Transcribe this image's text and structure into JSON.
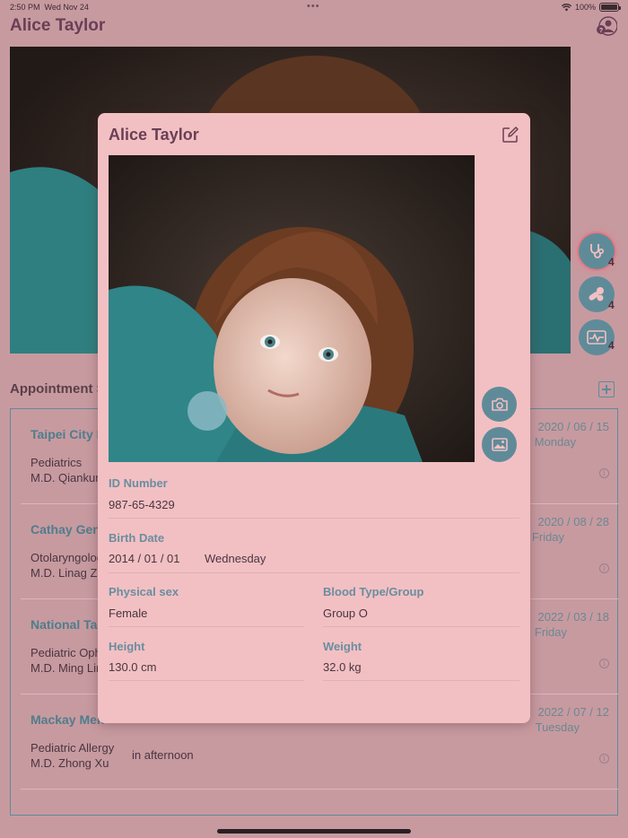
{
  "status_bar": {
    "time": "2:50 PM",
    "date": "Wed Nov 24",
    "battery": "100%"
  },
  "page": {
    "title": "Alice Taylor",
    "profile_icon": "person-help-icon"
  },
  "side_buttons": [
    {
      "icon": "stethoscope-icon",
      "badge": "4"
    },
    {
      "icon": "pills-icon",
      "badge": "4"
    },
    {
      "icon": "heart-monitor-icon",
      "badge": "4"
    }
  ],
  "appointments": {
    "title": "Appointment S",
    "items": [
      {
        "hospital": "Taipei City H",
        "department": "Pediatrics",
        "doctor": "M.D. Qiankun L",
        "note": "",
        "date": "2020 / 06 / 15",
        "day": "Monday"
      },
      {
        "hospital": "Cathay Gene",
        "department": "Otolaryngology",
        "doctor": "M.D. Linag Zha",
        "note": "",
        "date": "2020 / 08 / 28",
        "day": "Friday"
      },
      {
        "hospital": "National Taiv",
        "department": "Pediatric Ophtl",
        "doctor": "M.D. Ming Lin",
        "note": "",
        "date": "2022 / 03 / 18",
        "day": "Friday"
      },
      {
        "hospital": "Mackay Men",
        "department": "Pediatric Allergy",
        "doctor": "M.D. Zhong Xu",
        "note": "in afternoon",
        "date": "2022 / 07 / 12",
        "day": "Tuesday"
      }
    ]
  },
  "modal": {
    "title": "Alice Taylor",
    "id_label": "ID Number",
    "id_value": "987-65-4329",
    "birth_label": "Birth Date",
    "birth_value": "2014 / 01 / 01",
    "birth_day": "Wednesday",
    "sex_label": "Physical sex",
    "sex_value": "Female",
    "blood_label": "Blood Type/Group",
    "blood_value": "Group O",
    "height_label": "Height",
    "height_value": "130.0 cm",
    "weight_label": "Weight",
    "weight_value": "32.0 kg"
  },
  "colors": {
    "background": "#c79aa0",
    "modal": "#f2c0c3",
    "accent": "#5f8b99",
    "title": "#6a3f55"
  }
}
